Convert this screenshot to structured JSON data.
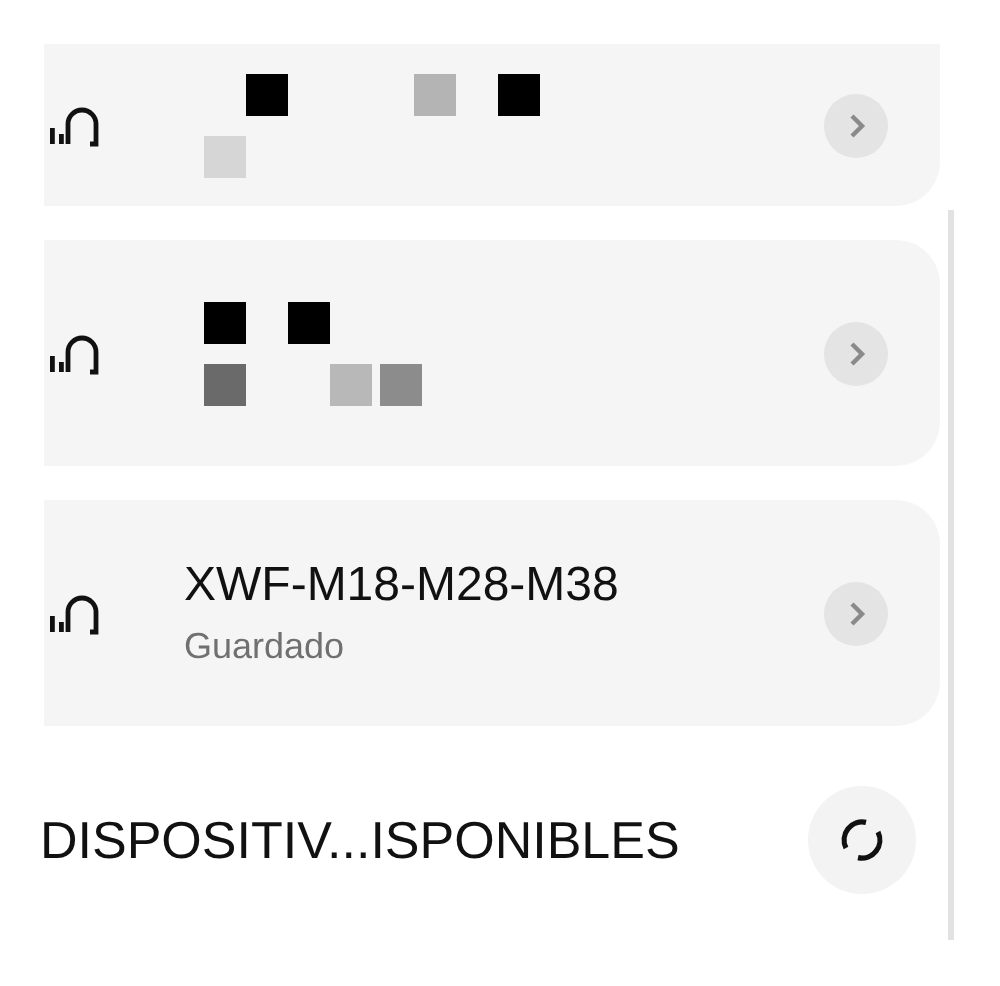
{
  "devices": [
    {
      "kind": "redacted"
    },
    {
      "kind": "redacted"
    },
    {
      "kind": "named",
      "name": "XWF-M18-M28-M38",
      "status": "Guardado"
    }
  ],
  "section": {
    "title": "DISPOSITIV...ISPONIBLES"
  }
}
